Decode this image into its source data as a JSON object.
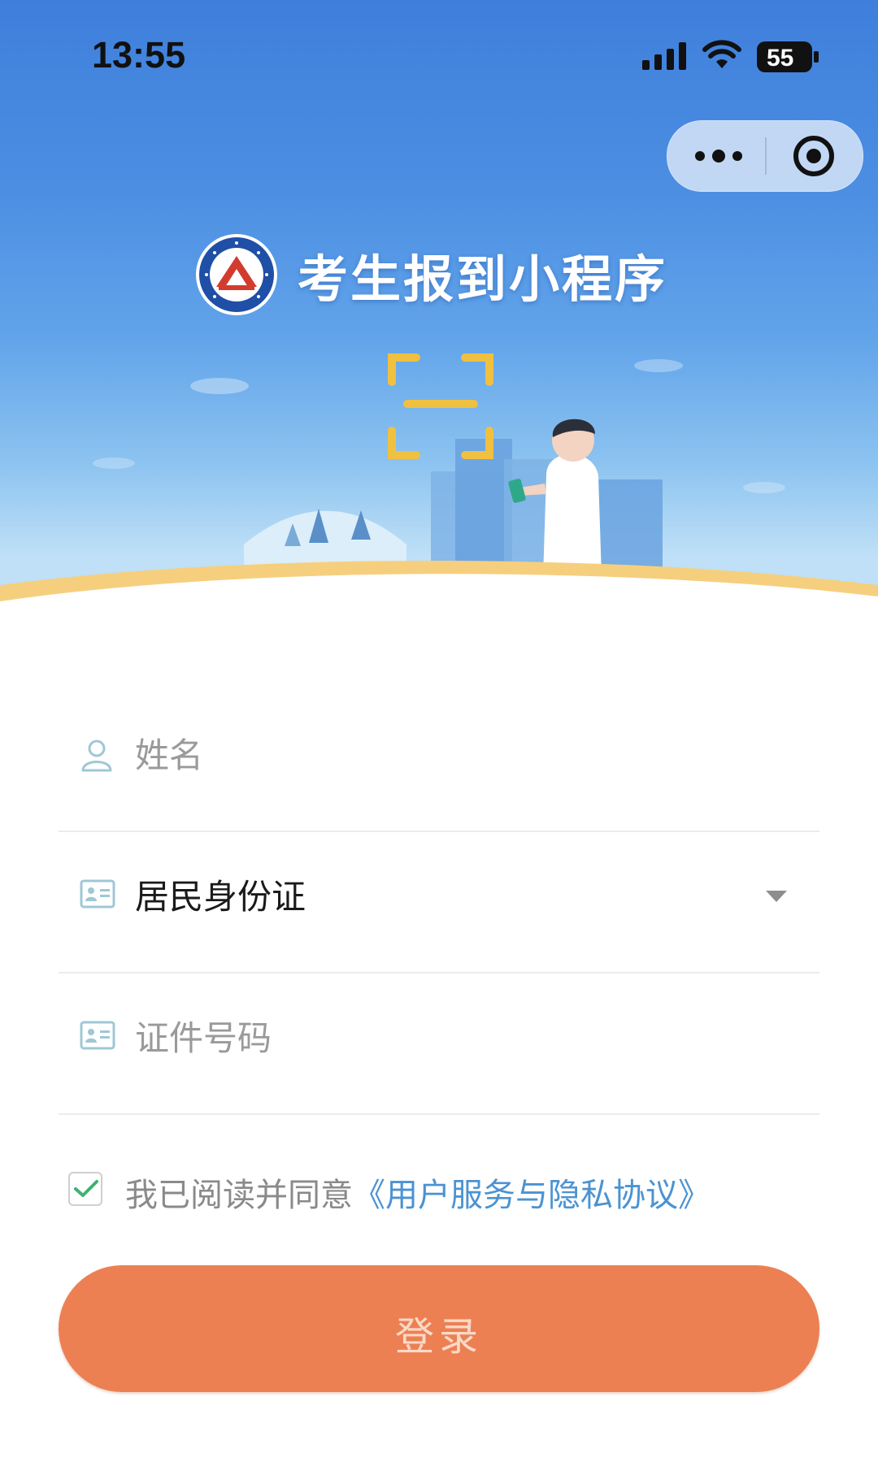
{
  "status_bar": {
    "time": "13:55",
    "battery_level": "55",
    "icons": [
      "signal-icon",
      "wifi-icon",
      "battery-icon"
    ]
  },
  "capsule": {
    "menu_icon": "more-dots-icon",
    "close_icon": "target-icon"
  },
  "header": {
    "title": "考生报到小程序",
    "logo_icon": "exam-authority-seal"
  },
  "form": {
    "name": {
      "placeholder": "姓名",
      "icon": "user-icon"
    },
    "id_type": {
      "value": "居民身份证",
      "icon": "id-card-icon",
      "arrow_icon": "triangle-down-icon"
    },
    "id_number": {
      "placeholder": "证件号码",
      "icon": "id-card-icon"
    }
  },
  "agreement": {
    "checked": true,
    "prefix": "我已阅读并同意",
    "link": "《用户服务与隐私协议》"
  },
  "login_button": {
    "label": "登录"
  },
  "colors": {
    "primary_blue": "#3f7fdc",
    "accent_orange": "#ec8053",
    "link_blue": "#4b93d2",
    "check_green": "#3cb371",
    "scan_yellow": "#f0c040"
  }
}
